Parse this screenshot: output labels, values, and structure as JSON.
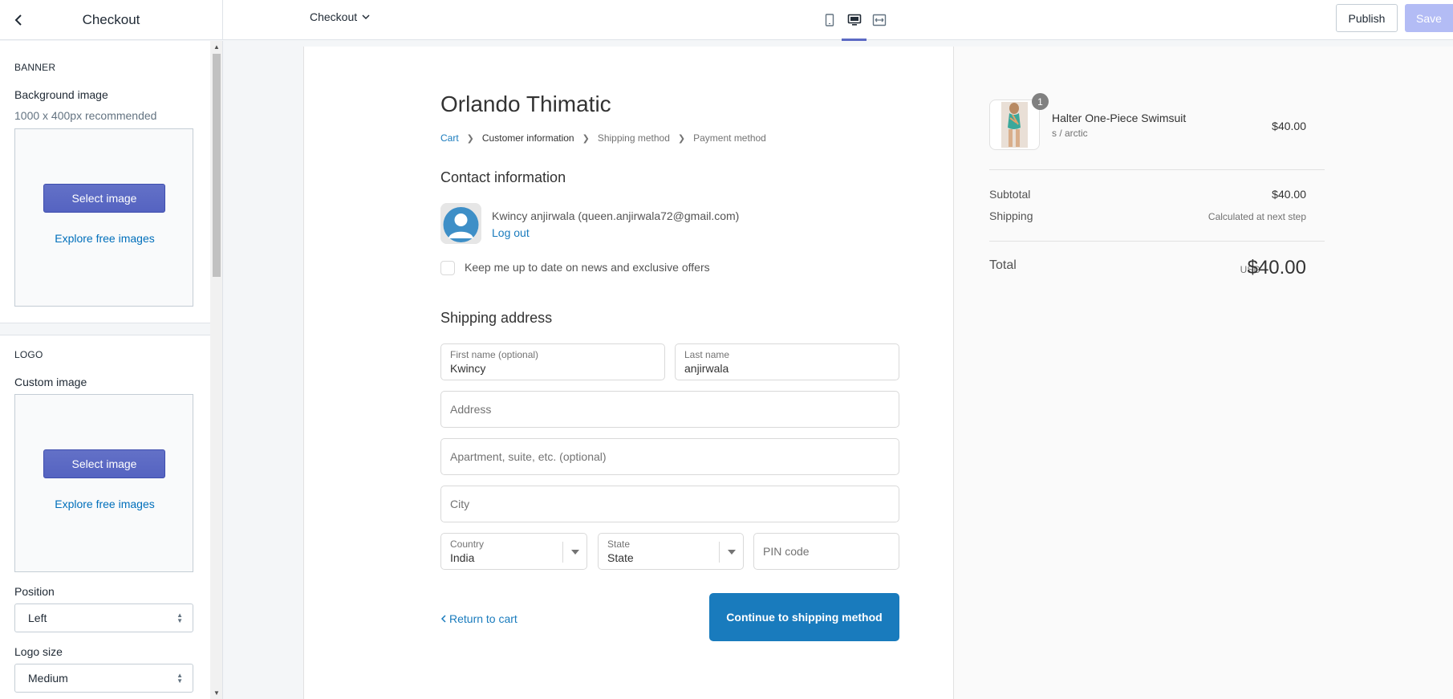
{
  "topbar": {
    "title": "Checkout",
    "page_select": "Checkout",
    "devices": [
      "mobile",
      "desktop",
      "fullscreen"
    ],
    "active_device": "desktop",
    "publish_label": "Publish",
    "save_label": "Save"
  },
  "sidebar": {
    "banner": {
      "heading": "BANNER",
      "label": "Background image",
      "hint": "1000 x 400px recommended",
      "select_label": "Select image",
      "explore_label": "Explore free images"
    },
    "logo": {
      "heading": "LOGO",
      "label": "Custom image",
      "select_label": "Select image",
      "explore_label": "Explore free images",
      "position_label": "Position",
      "position_value": "Left",
      "size_label": "Logo size",
      "size_value": "Medium"
    }
  },
  "checkout": {
    "store_name": "Orlando Thimatic",
    "breadcrumbs": [
      "Cart",
      "Customer information",
      "Shipping method",
      "Payment method"
    ],
    "contact_title": "Contact information",
    "contact_name": "Kwincy anjirwala (queen.anjirwala72@gmail.com)",
    "logout": "Log out",
    "newsletter": "Keep me up to date on news and exclusive offers",
    "shipping_title": "Shipping address",
    "first_name_label": "First name (optional)",
    "first_name_value": "Kwincy",
    "last_name_label": "Last name",
    "last_name_value": "anjirwala",
    "address_placeholder": "Address",
    "apartment_placeholder": "Apartment, suite, etc. (optional)",
    "city_placeholder": "City",
    "country_label": "Country",
    "country_value": "India",
    "state_label": "State",
    "state_value": "State",
    "pin_placeholder": "PIN code",
    "return_label": "Return to cart",
    "continue_label": "Continue to shipping method"
  },
  "summary": {
    "product_name": "Halter One-Piece Swimsuit",
    "product_variant": "s / arctic",
    "product_price": "$40.00",
    "quantity": "1",
    "subtotal_label": "Subtotal",
    "subtotal_value": "$40.00",
    "shipping_label": "Shipping",
    "shipping_value": "Calculated at next step",
    "total_label": "Total",
    "currency": "USD",
    "total_value": "$40.00"
  },
  "colors": {
    "accent": "#5c6ac4",
    "link": "#197bbd",
    "save_disabled": "#b3bcf5"
  }
}
